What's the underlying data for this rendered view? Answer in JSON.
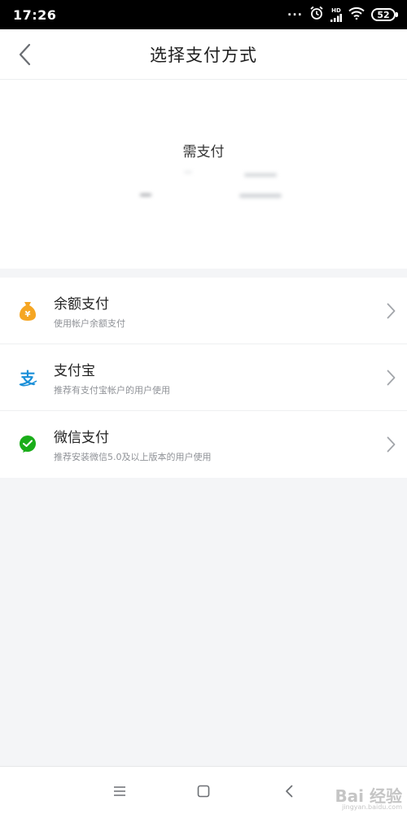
{
  "status_bar": {
    "time": "17:26",
    "dots": "...",
    "hd_label": "HD",
    "battery": "52"
  },
  "header": {
    "title": "选择支付方式"
  },
  "amount": {
    "label": "需支付"
  },
  "payment_methods": [
    {
      "name": "余额支付",
      "description": "使用帐户余额支付",
      "icon": "money-bag-icon",
      "icon_symbol": "¥",
      "color": "#f5a623"
    },
    {
      "name": "支付宝",
      "description": "推荐有支付宝帐户的用户使用",
      "icon": "alipay-icon",
      "icon_symbol": "支",
      "color": "#1a8fd8"
    },
    {
      "name": "微信支付",
      "description": "推荐安装微信5.0及以上版本的用户使用",
      "icon": "wechat-pay-icon",
      "color": "#1aad19"
    }
  ],
  "watermark": {
    "text": "Bai 经验",
    "url": "jingyan.baidu.com"
  }
}
